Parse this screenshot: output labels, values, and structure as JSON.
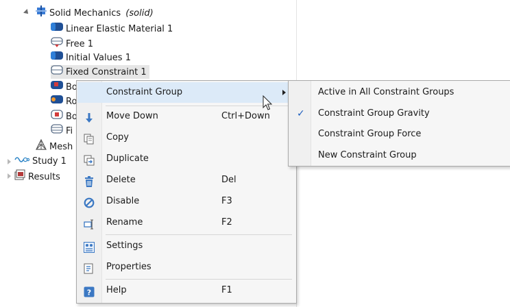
{
  "tree": {
    "solid_mechanics": {
      "label": "Solid Mechanics",
      "qualifier": "(solid)"
    },
    "children": [
      {
        "label": "Linear Elastic Material 1",
        "icon": "material-icon"
      },
      {
        "label": "Free 1",
        "icon": "free-icon"
      },
      {
        "label": "Initial Values 1",
        "icon": "initial-values-icon"
      },
      {
        "label": "Fixed Constraint 1",
        "icon": "fixed-constraint-icon",
        "selected": true
      },
      {
        "label": "Bo",
        "icon": "boundary-load-icon"
      },
      {
        "label": "Ro",
        "icon": "rotation-icon"
      },
      {
        "label": "Bo",
        "icon": "body-load-icon"
      },
      {
        "label": "Fi",
        "icon": "fixed-icon"
      }
    ],
    "mesh": "Mesh",
    "study": "Study 1",
    "results": "Results"
  },
  "context_menu": {
    "constraint_group": "Constraint Group",
    "move_down": "Move Down",
    "move_down_key": "Ctrl+Down",
    "copy": "Copy",
    "duplicate": "Duplicate",
    "delete": "Delete",
    "delete_key": "Del",
    "disable": "Disable",
    "disable_key": "F3",
    "rename": "Rename",
    "rename_key": "F2",
    "settings": "Settings",
    "properties": "Properties",
    "help": "Help",
    "help_key": "F1"
  },
  "submenu": {
    "items": [
      {
        "label": "Active in All Constraint Groups",
        "checked": false
      },
      {
        "label": "Constraint Group Gravity",
        "checked": true
      },
      {
        "label": "Constraint Group Force",
        "checked": false
      },
      {
        "label": "New Constraint Group",
        "checked": false
      }
    ],
    "check_mark": "✓"
  },
  "colors": {
    "accent": "#1f5fbf",
    "menu_highlight": "#dceaf8",
    "selected_row": "#e6e6e6"
  }
}
